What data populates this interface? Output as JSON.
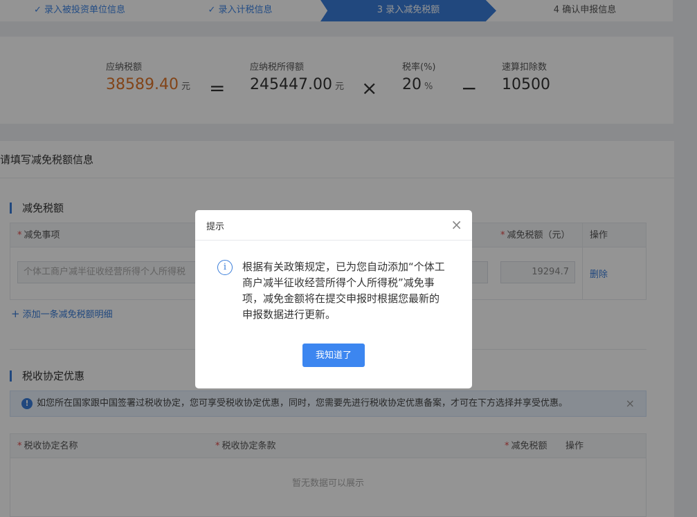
{
  "steps": [
    {
      "label": "录入被投资单位信息",
      "done": true
    },
    {
      "label": "录入计税信息",
      "done": true
    },
    {
      "label": "3 录入减免税额",
      "active": true
    },
    {
      "label": "4 确认申报信息"
    }
  ],
  "check_glyph": "✓",
  "calc": {
    "tax_payable_label": "应纳税额",
    "tax_payable_value": "38589.40",
    "tax_payable_unit": "元",
    "op_equals": "=",
    "taxable_income_label": "应纳税所得额",
    "taxable_income_value": "245447.00",
    "taxable_income_unit": "元",
    "op_times": "×",
    "rate_label": "税率(%)",
    "rate_value": "20",
    "rate_unit": "%",
    "op_minus": "−",
    "deduction_label": "速算扣除数",
    "deduction_value": "10500",
    "highlight_color": "#e0762a"
  },
  "form": {
    "panel_title": "请填写减免税额信息",
    "reduction": {
      "title": "减免税额",
      "col_item": "减免事项",
      "col_amount": "减免税额（元）",
      "col_action": "操作",
      "required_mark": "*",
      "row_item_value": "个体工商户减半征收经营所得个人所得税",
      "row_amount_value": "19294.7",
      "row_action": "删除",
      "add_link": "添加一条减免税额明细",
      "add_icon": "+"
    },
    "treaty": {
      "title": "税收协定优惠",
      "notice": "如您所在国家跟中国签署过税收协定，您可享受税收协定优惠，同时，您需要先进行税收协定优惠备案，才可在下方选择并享受优惠。",
      "notice_icon": "!",
      "notice_close": "×",
      "col_name": "税收协定名称",
      "col_clause": "税收协定条款",
      "col_amount": "减免税额",
      "col_action": "操作",
      "empty_text": "暂无数据可以展示"
    }
  },
  "modal": {
    "title": "提示",
    "close": "×",
    "info_icon": "i",
    "message": "根据有关政策规定，已为您自动添加“个体工商户减半征收经营所得个人所得税”减免事项，减免金额将在提交申报时根据您最新的申报数据进行更新。",
    "ok_label": "我知道了"
  },
  "colors": {
    "accent": "#3a7dd9",
    "button": "#3c86f0",
    "required": "#e04848"
  }
}
